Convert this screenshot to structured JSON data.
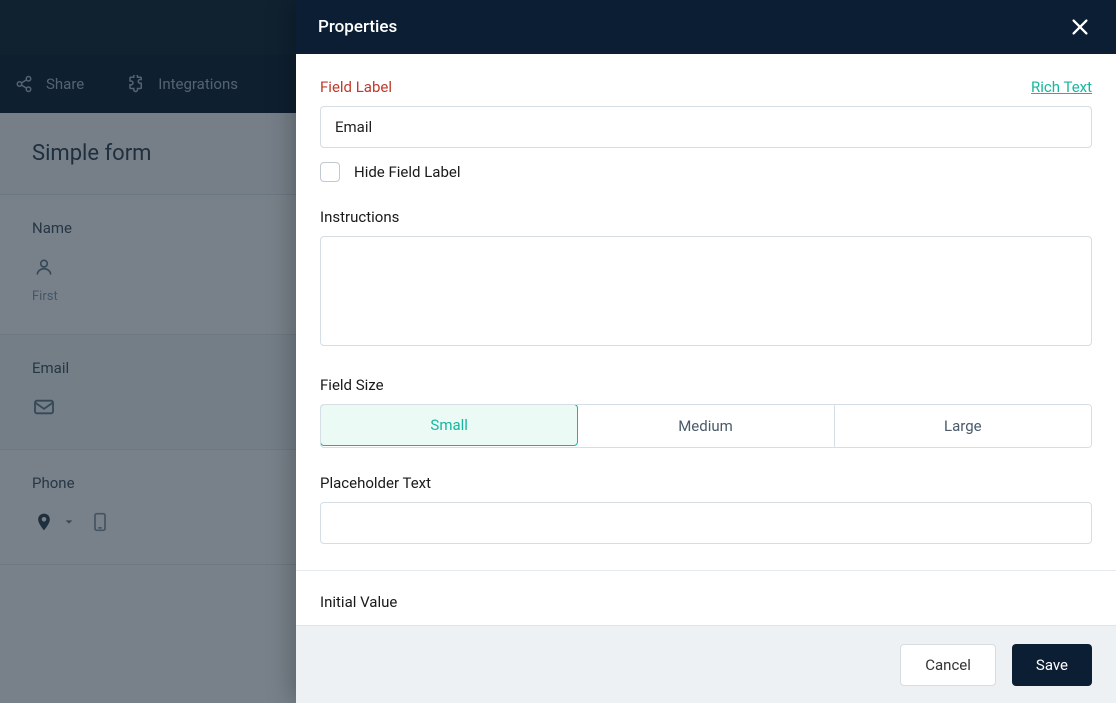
{
  "background": {
    "toolbar": {
      "share": "Share",
      "integrations": "Integrations"
    },
    "form": {
      "title": "Simple form",
      "fields": {
        "name": {
          "label": "Name",
          "sub": "First"
        },
        "email": {
          "label": "Email"
        },
        "phone": {
          "label": "Phone"
        }
      }
    }
  },
  "panel": {
    "title": "Properties",
    "field_label": {
      "label": "Field Label",
      "value": "Email",
      "rich_text": "Rich Text",
      "hide_checkbox": "Hide Field Label"
    },
    "instructions": {
      "label": "Instructions",
      "value": ""
    },
    "field_size": {
      "label": "Field Size",
      "options": [
        "Small",
        "Medium",
        "Large"
      ],
      "selected": "Small"
    },
    "placeholder": {
      "label": "Placeholder Text",
      "value": ""
    },
    "initial_value": {
      "label": "Initial Value"
    },
    "footer": {
      "cancel": "Cancel",
      "save": "Save"
    }
  }
}
